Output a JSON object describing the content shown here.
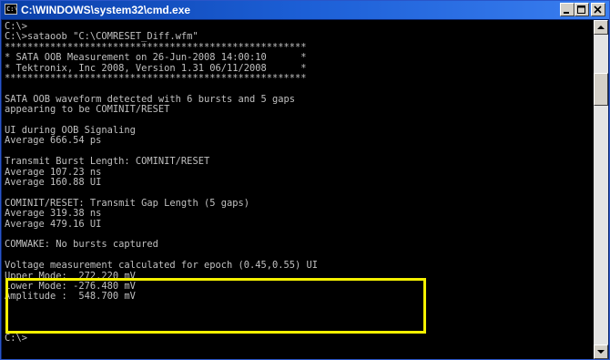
{
  "window": {
    "title": "C:\\WINDOWS\\system32\\cmd.exe",
    "icon_text": "C:\\"
  },
  "controls": {
    "minimize_icon": "minimize-icon",
    "maximize_icon": "maximize-icon",
    "close_icon": "close-icon"
  },
  "console": {
    "lines": [
      "C:\\>",
      "C:\\>sataoob \"C:\\COMRESET_Diff.wfm\"",
      "*****************************************************",
      "* SATA OOB Measurement on 26-Jun-2008 14:00:10      *",
      "* Tektronix, Inc 2008, Version 1.31 06/11/2008      *",
      "*****************************************************",
      "",
      "SATA OOB waveform detected with 6 bursts and 5 gaps",
      "appearing to be COMINIT/RESET",
      "",
      "UI during OOB Signaling",
      "Average 666.54 ps",
      "",
      "Transmit Burst Length: COMINIT/RESET",
      "Average 107.23 ns",
      "Average 160.88 UI",
      "",
      "COMINIT/RESET: Transmit Gap Length (5 gaps)",
      "Average 319.38 ns",
      "Average 479.16 UI",
      "",
      "COMWAKE: No bursts captured",
      "",
      "Voltage measurement calculated for epoch (0.45,0.55) UI",
      "Upper Mode:  272.220 mV",
      "Lower Mode: -276.480 mV",
      "Amplitude :  548.700 mV",
      "",
      "",
      "",
      "C:\\>"
    ]
  },
  "highlight": {
    "color": "#f4f000"
  },
  "colors": {
    "console_bg": "#000000",
    "console_text": "#c0c0c0",
    "titlebar": "#0a3fa8"
  }
}
